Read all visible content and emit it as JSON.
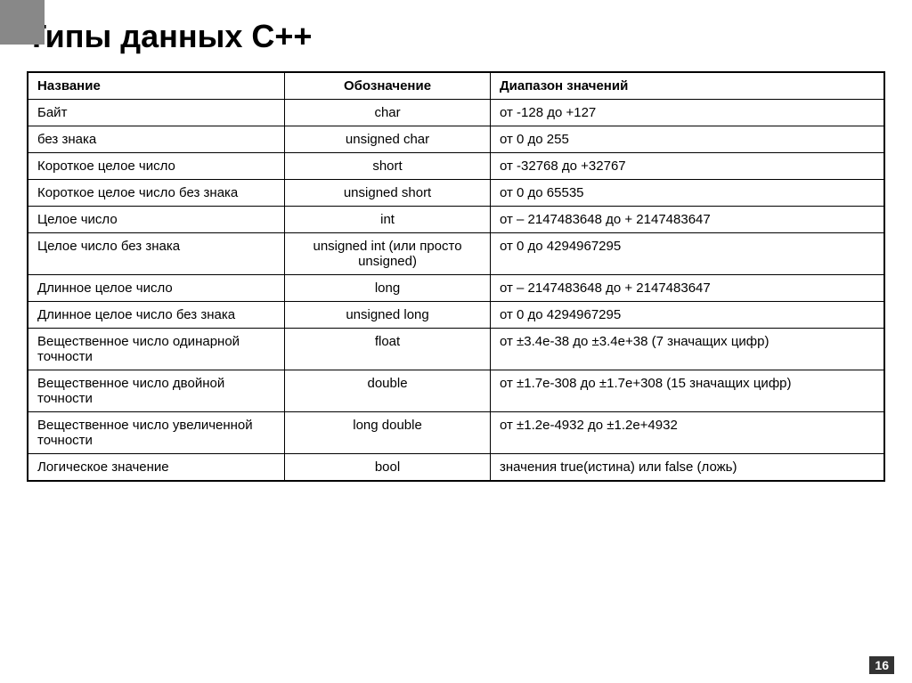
{
  "header": {
    "decoration": true
  },
  "title": "Типы данных С++",
  "table": {
    "columns": [
      "Название",
      "Обозначение",
      "Диапазон значений"
    ],
    "rows": [
      {
        "name": "Байт",
        "notation": "char",
        "range": "от -128 до +127"
      },
      {
        "name": "без знака",
        "notation": "unsigned char",
        "range": "от 0 до 255"
      },
      {
        "name": "Короткое целое число",
        "notation": "short",
        "range": "от -32768 до +32767"
      },
      {
        "name": "Короткое целое число без знака",
        "notation": "unsigned short",
        "range": "от 0 до 65535"
      },
      {
        "name": "Целое число",
        "notation": "int",
        "range": "от – 2147483648 до + 2147483647"
      },
      {
        "name": "Целое число без знака",
        "notation": "unsigned int (или просто unsigned)",
        "range": "от 0 до 4294967295"
      },
      {
        "name": "Длинное целое число",
        "notation": "long",
        "range": "от – 2147483648 до + 2147483647"
      },
      {
        "name": "Длинное целое число без знака",
        "notation": "unsigned long",
        "range": "от 0 до 4294967295"
      },
      {
        "name": "Вещественное число одинарной точности",
        "notation": "float",
        "range": "от ±3.4е-38 до ±3.4е+38 (7 значащих цифр)"
      },
      {
        "name": "Вещественное число двойной точности",
        "notation": "double",
        "range": "от ±1.7е-308 до ±1.7е+308 (15 значащих цифр)"
      },
      {
        "name": "Вещественное число увеличенной точности",
        "notation": "long double",
        "range": "от ±1.2е-4932 до ±1.2е+4932"
      },
      {
        "name": "Логическое значение",
        "notation": "bool",
        "range": "значения true(истина) или false (ложь)"
      }
    ]
  },
  "page_number": "16"
}
